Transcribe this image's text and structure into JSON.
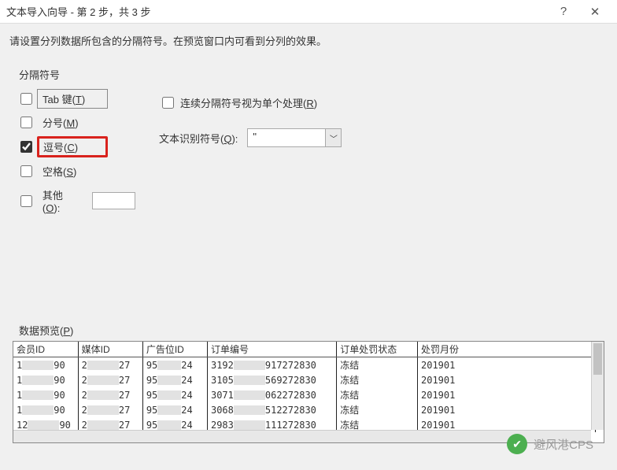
{
  "title": "文本导入向导 - 第 2 步，共 3 步",
  "instruction": "请设置分列数据所包含的分隔符号。在预览窗口内可看到分列的效果。",
  "delimiter_group_label": "分隔符号",
  "delimiters": {
    "tab": {
      "label": "Tab 键(T)",
      "checked": false
    },
    "semicolon": {
      "label": "分号(M)",
      "checked": false
    },
    "comma": {
      "label": "逗号(C)",
      "checked": true
    },
    "space": {
      "label": "空格(S)",
      "checked": false
    },
    "other": {
      "label": "其他(O):",
      "checked": false,
      "value": ""
    }
  },
  "consecutive": {
    "label": "连续分隔符号视为单个处理(R)",
    "checked": false
  },
  "text_qualifier": {
    "label": "文本识别符号(Q):",
    "value": "\""
  },
  "preview_label": "数据预览(P)",
  "columns": [
    "会员ID",
    "媒体ID",
    "广告位ID",
    "订单编号",
    "订单处罚状态",
    "处罚月份"
  ],
  "rows": [
    {
      "member_pre": "1",
      "member_suf": "90",
      "media_pre": "2",
      "media_suf": "27",
      "ad_pre": "95",
      "ad_suf": "24",
      "order_pre": "3192",
      "order_suf": "917272830",
      "status": "冻结",
      "month": "201901"
    },
    {
      "member_pre": "1",
      "member_suf": "90",
      "media_pre": "2",
      "media_suf": "27",
      "ad_pre": "95",
      "ad_suf": "24",
      "order_pre": "3105",
      "order_suf": "569272830",
      "status": "冻结",
      "month": "201901"
    },
    {
      "member_pre": "1",
      "member_suf": "90",
      "media_pre": "2",
      "media_suf": "27",
      "ad_pre": "95",
      "ad_suf": "24",
      "order_pre": "3071",
      "order_suf": "062272830",
      "status": "冻结",
      "month": "201901"
    },
    {
      "member_pre": "1",
      "member_suf": "90",
      "media_pre": "2",
      "media_suf": "27",
      "ad_pre": "95",
      "ad_suf": "24",
      "order_pre": "3068",
      "order_suf": "512272830",
      "status": "冻结",
      "month": "201901"
    },
    {
      "member_pre": "12",
      "member_suf": "90",
      "media_pre": "2",
      "media_suf": "27",
      "ad_pre": "95",
      "ad_suf": "24",
      "order_pre": "2983",
      "order_suf": "111272830",
      "status": "冻结",
      "month": "201901"
    }
  ],
  "watermark": "避风港CPS"
}
